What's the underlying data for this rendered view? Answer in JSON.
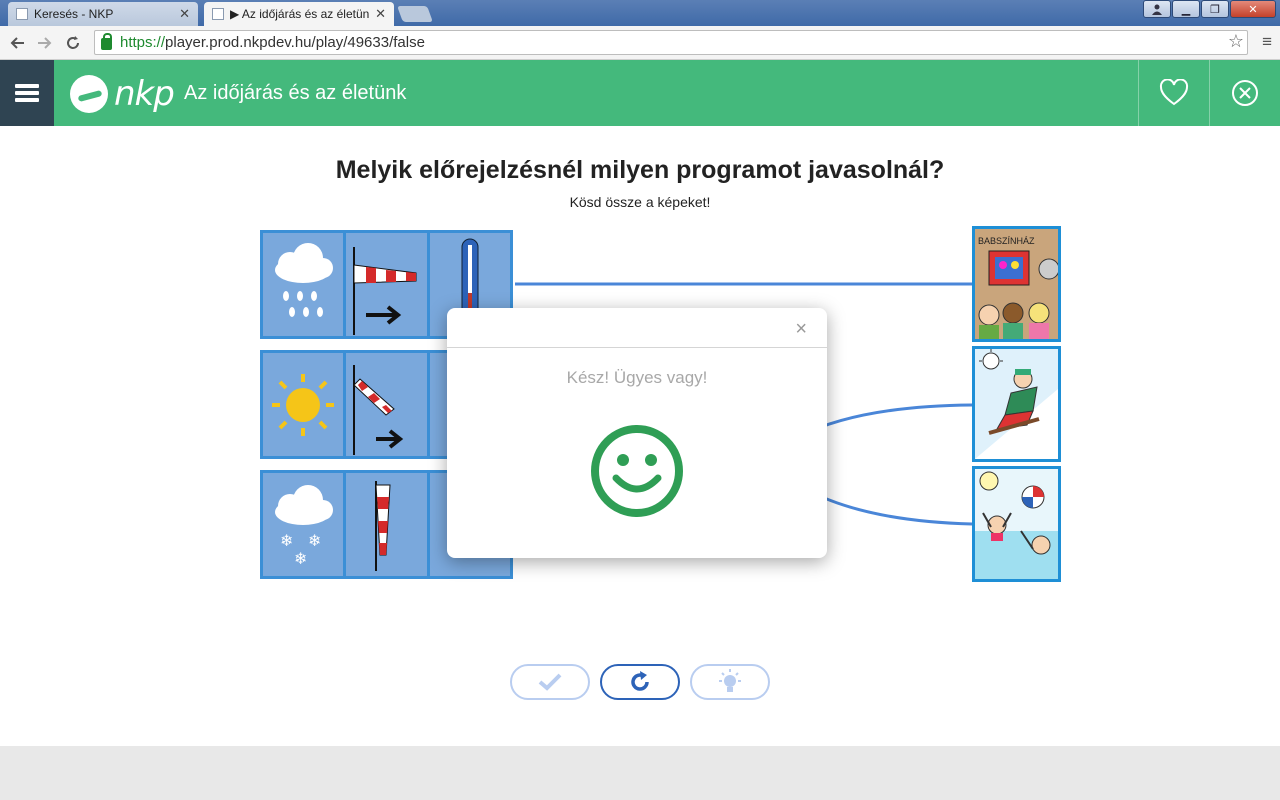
{
  "browser": {
    "tabs": [
      {
        "title": "Keresés - NKP",
        "active": false
      },
      {
        "title": "▶ Az időjárás és az életün",
        "active": true
      }
    ],
    "url_scheme": "https://",
    "url_rest": "player.prod.nkpdev.hu/play/49633/false",
    "icons": {
      "back": "back-arrow-icon",
      "forward": "forward-arrow-icon",
      "reload": "reload-icon",
      "star": "star-icon",
      "menu": "menu-icon"
    }
  },
  "app": {
    "logo_text": "nkp",
    "title": "Az időjárás és az életünk",
    "brand_color": "#44b97c",
    "menu_color": "#2f4452"
  },
  "exercise": {
    "question": "Melyik előrejelzésnél milyen programot javasolnál?",
    "instruction": "Kösd össze a képeket!",
    "forecast_rows": [
      {
        "weather": "rain-cloud-icon",
        "wind": "windsock-strong-icon",
        "temperature": "thermometer-icon"
      },
      {
        "weather": "sun-icon",
        "wind": "windsock-medium-icon",
        "temperature": "thermometer-icon"
      },
      {
        "weather": "snow-cloud-icon",
        "wind": "windsock-calm-icon",
        "temperature": "thermometer-icon"
      }
    ],
    "activities": [
      {
        "name": "puppet-theatre-picture",
        "sign_text": "BABSZÍNHÁZ"
      },
      {
        "name": "sledding-picture"
      },
      {
        "name": "beach-picture"
      }
    ]
  },
  "modal": {
    "message": "Kész! Ügyes vagy!",
    "close": "×",
    "icon": "smiley-icon",
    "icon_color": "#2f9e55"
  },
  "actions": [
    {
      "name": "check-button",
      "icon": "check-icon",
      "enabled": false
    },
    {
      "name": "reset-button",
      "icon": "reset-icon",
      "enabled": true
    },
    {
      "name": "hint-button",
      "icon": "lightbulb-icon",
      "enabled": false
    }
  ]
}
